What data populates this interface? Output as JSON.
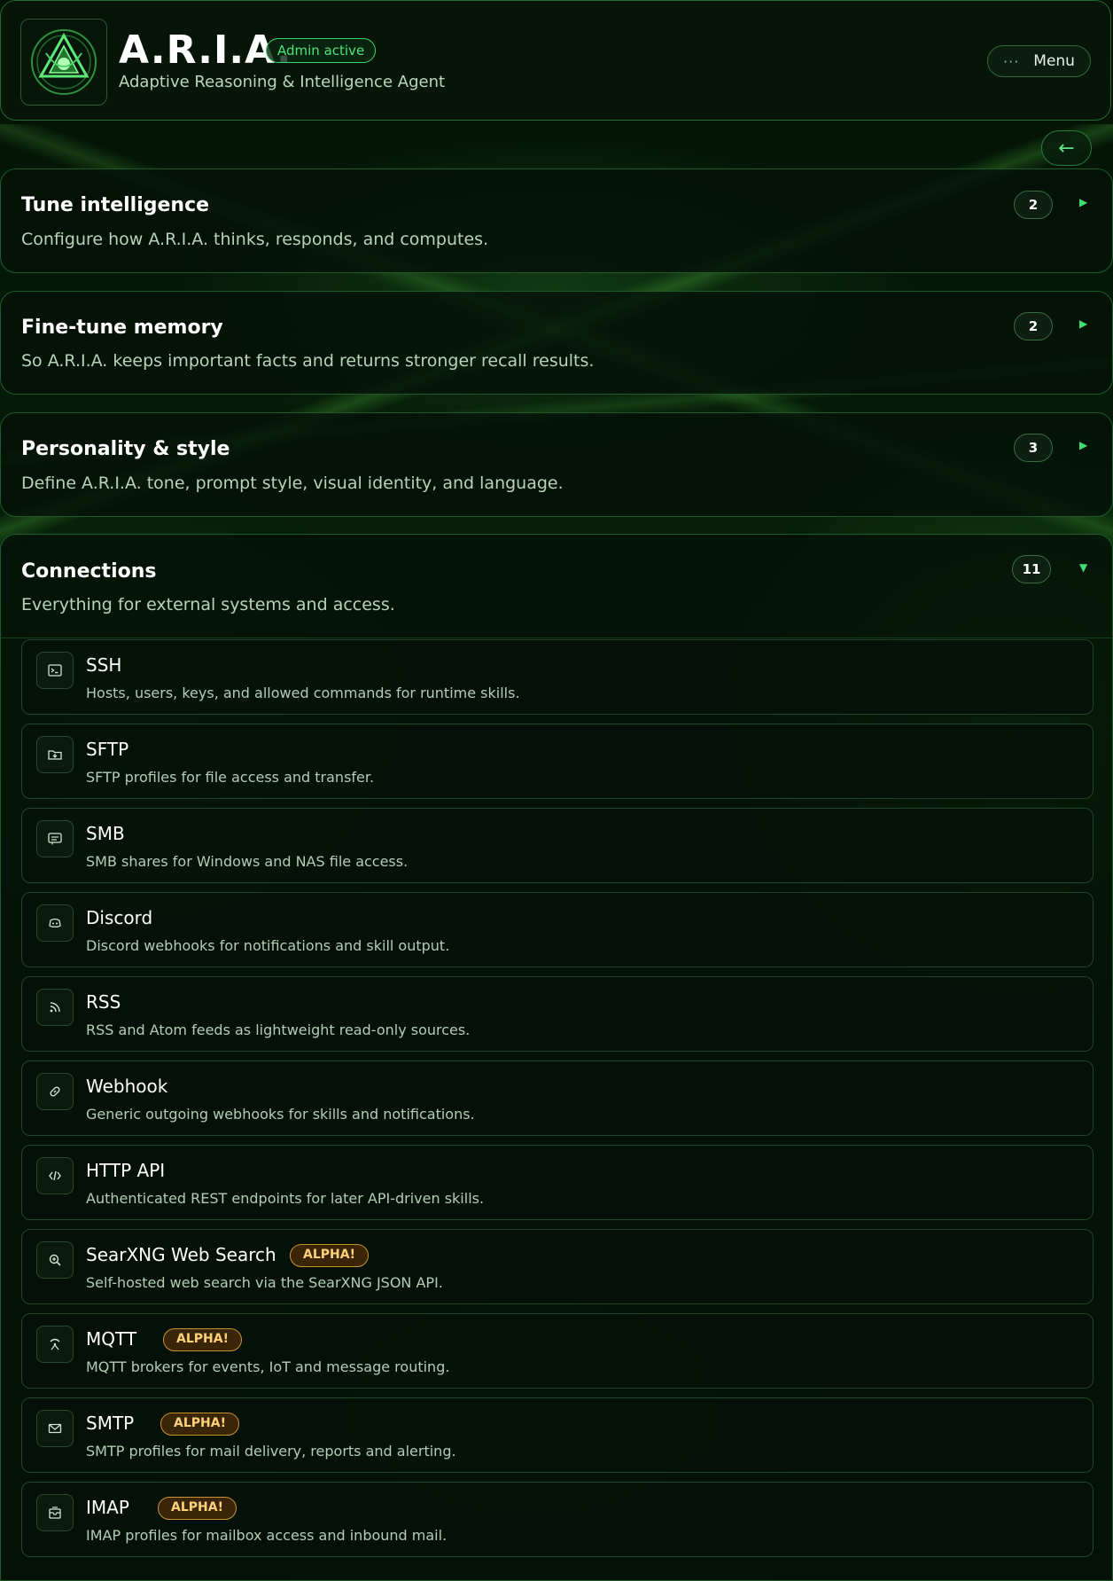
{
  "header": {
    "title": "A.R.I.A.",
    "badge": "Admin active",
    "subtitle": "Adaptive Reasoning & Intelligence Agent",
    "menu_label": "Menu",
    "back_label": "←"
  },
  "sections": [
    {
      "title": "Tune intelligence",
      "desc": "Configure how A.R.I.A. thinks, responds, and computes.",
      "count": "2",
      "state": "collapsed"
    },
    {
      "title": "Fine-tune memory",
      "desc": "So A.R.I.A. keeps important facts and returns stronger recall results.",
      "count": "2",
      "state": "collapsed"
    },
    {
      "title": "Personality & style",
      "desc": "Define A.R.I.A. tone, prompt style, visual identity, and language.",
      "count": "3",
      "state": "collapsed"
    },
    {
      "title": "Connections",
      "desc": "Everything for external systems and access.",
      "count": "11",
      "state": "expanded"
    }
  ],
  "connections": [
    {
      "title": "SSH",
      "desc": "Hosts, users, keys, and allowed commands for runtime skills.",
      "icon": "terminal-icon"
    },
    {
      "title": "SFTP",
      "desc": "SFTP profiles for file access and transfer.",
      "icon": "folder-icon"
    },
    {
      "title": "SMB",
      "desc": "SMB shares for Windows and NAS file access.",
      "icon": "share-icon"
    },
    {
      "title": "Discord",
      "desc": "Discord webhooks for notifications and skill output.",
      "icon": "discord-icon"
    },
    {
      "title": "RSS",
      "desc": "RSS and Atom feeds as lightweight read-only sources.",
      "icon": "rss-icon"
    },
    {
      "title": "Webhook",
      "desc": "Generic outgoing webhooks for skills and notifications.",
      "icon": "link-icon"
    },
    {
      "title": "HTTP API",
      "desc": "Authenticated REST endpoints for later API-driven skills.",
      "icon": "code-icon"
    },
    {
      "title": "SearXNG Web Search",
      "desc": "Self-hosted web search via the SearXNG JSON API.",
      "icon": "search-icon",
      "badge": "ALPHA!"
    },
    {
      "title": "MQTT",
      "desc": "MQTT brokers for events, IoT and message routing.",
      "icon": "broadcast-icon",
      "badge": "ALPHA!"
    },
    {
      "title": "SMTP",
      "desc": "SMTP profiles for mail delivery, reports and alerting.",
      "icon": "mail-icon",
      "badge": "ALPHA!"
    },
    {
      "title": "IMAP",
      "desc": "IMAP profiles for mailbox access and inbound mail.",
      "icon": "inbox-icon",
      "badge": "ALPHA!"
    }
  ],
  "colors": {
    "accent": "#3fd567",
    "alpha": "#c8922a",
    "background": "#031205"
  }
}
